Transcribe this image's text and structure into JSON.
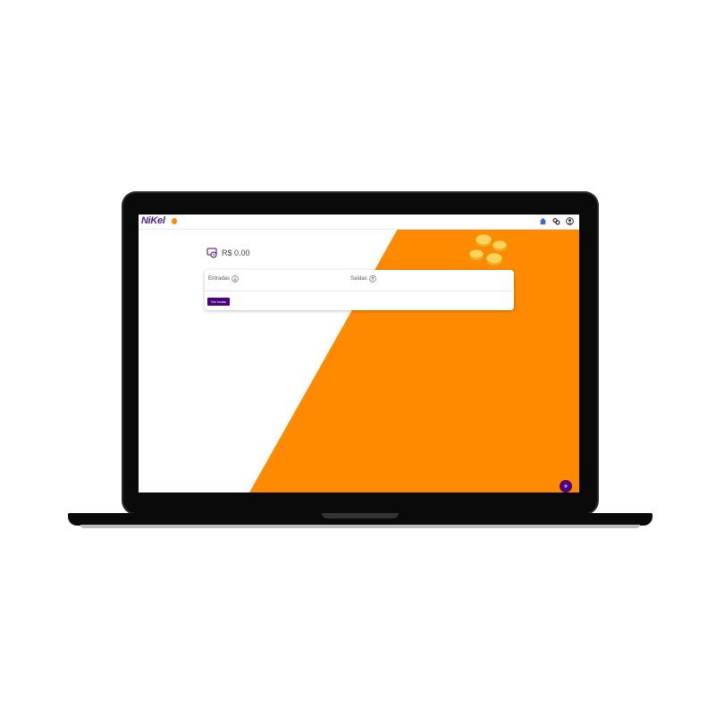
{
  "app": {
    "logo_text": "NiKel"
  },
  "navbar": {
    "icons": [
      "home-icon",
      "transactions-icon",
      "user-icon"
    ]
  },
  "balance": {
    "amount_text": "R$ 0.00",
    "icon": "wallet-icon"
  },
  "summary": {
    "incoming_label": "Entradas",
    "outgoing_label": "Saídas",
    "see_all_label": "Ver todas"
  },
  "fab": {
    "label": "+"
  },
  "colors": {
    "brand_purple": "#4b0082",
    "accent_orange": "#ff8a00",
    "laptop_body": "#0a0a0a"
  }
}
